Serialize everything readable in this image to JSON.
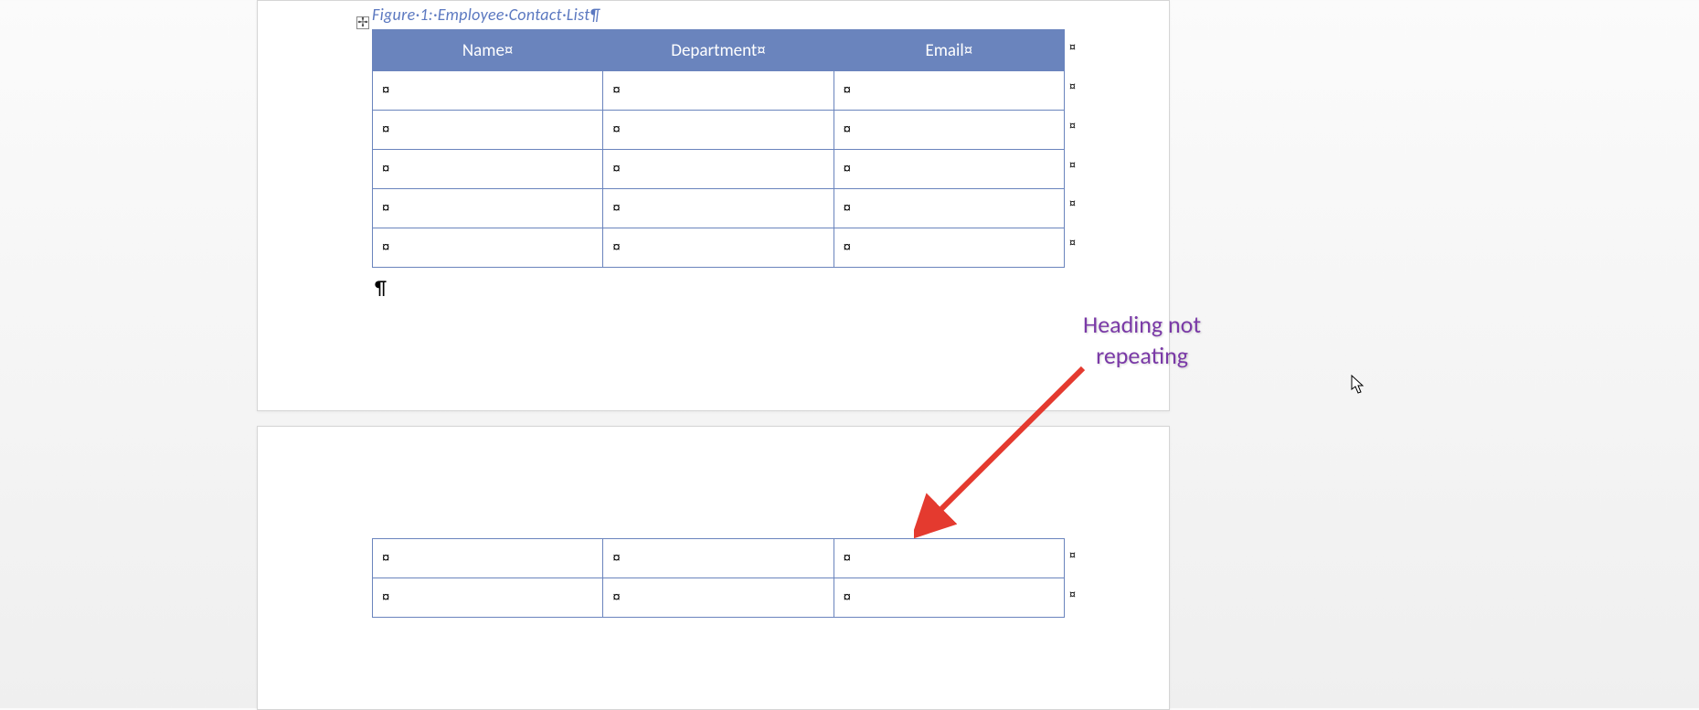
{
  "caption": "Figure·1:·Employee·Contact·List¶",
  "moveHandleGlyph": "✢",
  "headers": {
    "col1": "Name¤",
    "col2": "Department¤",
    "col3": "Email¤"
  },
  "cellMark": "¤",
  "rowEndMark": "¤",
  "paragraphMark": "¶",
  "page1": {
    "bodyRows": 5
  },
  "page2": {
    "bodyRows": 2
  },
  "annotation": {
    "line1": "Heading not",
    "line2": "repeating"
  }
}
